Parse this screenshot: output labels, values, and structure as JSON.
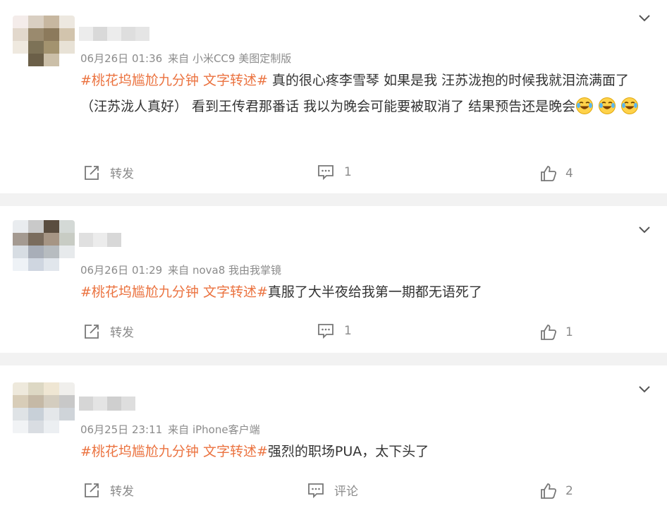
{
  "comments": [
    {
      "time": "06月26日 01:36",
      "source": "来自 小米CC9 美图定制版",
      "topic": "#桃花坞尴尬九分钟 文字转述#",
      "body": " 真的很心疼李雪琴 如果是我 汪苏泷抱的时候我就泪流满面了（汪苏泷人真好） 看到王传君那番话 我以为晚会可能要被取消了 结果预告还是晚会",
      "emoji_count": 3,
      "emoji": "laugh-cry-emoji",
      "repost_label": "转发",
      "comment_label": "1",
      "like_count": "4"
    },
    {
      "time": "06月26日 01:29",
      "source": "来自 nova8 我由我掌镜",
      "topic": "#桃花坞尴尬九分钟 文字转述#",
      "body": "真服了大半夜给我第一期都无语死了",
      "emoji_count": 0,
      "repost_label": "转发",
      "comment_label": "1",
      "like_count": "1"
    },
    {
      "time": "06月25日 23:11",
      "source": "来自 iPhone客户端",
      "topic": "#桃花坞尴尬九分钟 文字转述#",
      "body": "强烈的职场PUA，太下头了",
      "emoji_count": 0,
      "repost_label": "转发",
      "comment_label": "评论",
      "like_count": "2"
    }
  ],
  "colors": {
    "topic": "#eb7340",
    "text": "#333333",
    "meta": "#8b8b8b",
    "separator": "#f2f2f2"
  }
}
